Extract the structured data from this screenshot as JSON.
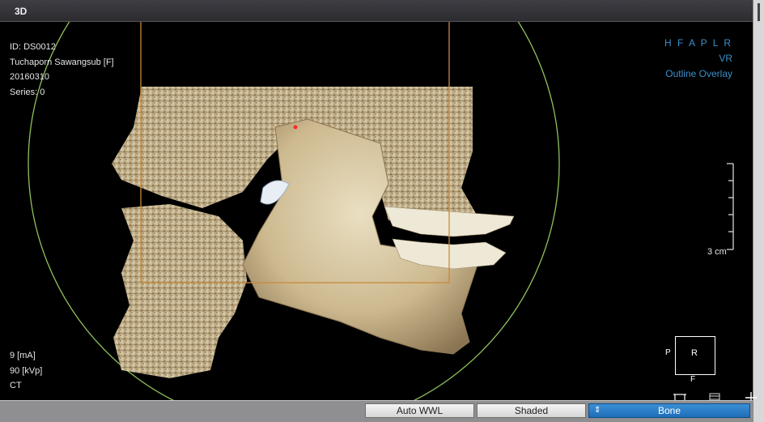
{
  "window": {
    "title": "3D"
  },
  "overlay": {
    "top_left": [
      "ID: DS0012",
      "Tuchaporn Sawangsub [F]",
      "20160310",
      "Series: 0"
    ],
    "bottom_left": [
      "9 [mA]",
      "90 [kVp]",
      "CT"
    ],
    "top_right": {
      "orientation": "H F A P L R",
      "mode": "VR",
      "overlay": "Outline Overlay"
    },
    "scale_label": "3 cm"
  },
  "orientation_cube": {
    "face": "R",
    "left": "P",
    "bottom": "F"
  },
  "toolbar": {
    "auto_wwl": "Auto WWL",
    "shaded": "Shaded",
    "preset_value": "Bone"
  },
  "colors": {
    "overlay_blue": "#3c8fc9",
    "bone": "#d8c8a0",
    "crop_box": "#c88a3a",
    "circle": "#8fc25a",
    "select_blue": "#1d6eb8"
  }
}
